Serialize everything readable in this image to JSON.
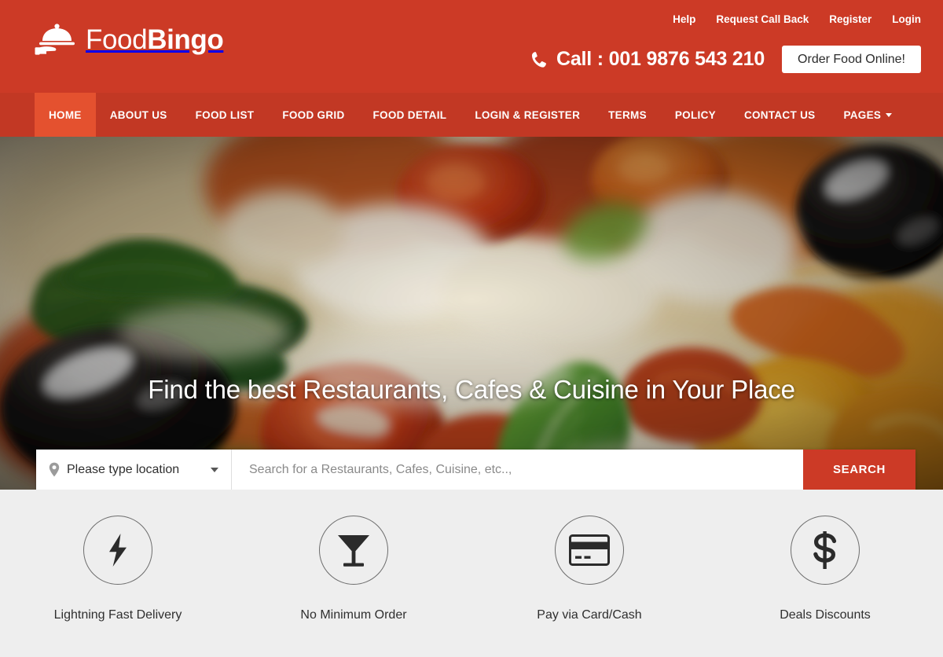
{
  "brand": {
    "name_light": "Food",
    "name_bold": "Bingo",
    "logo_icon": "food-tray-hand-icon",
    "primary_color": "#cc3a26",
    "nav_color": "#c23824",
    "active_color": "#e4512f",
    "features_bg": "#eeeeee"
  },
  "header": {
    "top_links": [
      {
        "label": "Help"
      },
      {
        "label": "Request Call Back"
      },
      {
        "label": "Register"
      },
      {
        "label": "Login"
      }
    ],
    "phone_icon": "phone-icon",
    "call_text": "Call : 001 9876 543 210",
    "order_button": "Order Food Online!"
  },
  "nav": {
    "items": [
      {
        "label": "HOME",
        "active": true,
        "dropdown": false
      },
      {
        "label": "ABOUT US",
        "active": false,
        "dropdown": false
      },
      {
        "label": "FOOD LIST",
        "active": false,
        "dropdown": false
      },
      {
        "label": "FOOD GRID",
        "active": false,
        "dropdown": false
      },
      {
        "label": "FOOD DETAIL",
        "active": false,
        "dropdown": false
      },
      {
        "label": "LOGIN & REGISTER",
        "active": false,
        "dropdown": false
      },
      {
        "label": "TERMS",
        "active": false,
        "dropdown": false
      },
      {
        "label": "POLICY",
        "active": false,
        "dropdown": false
      },
      {
        "label": "CONTACT US",
        "active": false,
        "dropdown": false
      },
      {
        "label": "PAGES",
        "active": false,
        "dropdown": true
      }
    ]
  },
  "hero": {
    "title": "Find the best Restaurants, Cafes & Cuisine in Your Place",
    "background_description": "close-up photo of pizza with basil leaves, tomatoes, black olives and melted cheese",
    "search": {
      "location_icon": "map-pin-icon",
      "location_value": "Please type location",
      "location_caret_icon": "chevron-down-icon",
      "query_value": "",
      "query_placeholder": "Search for a Restaurants, Cafes, Cuisine, etc..,",
      "search_button": "SEARCH"
    }
  },
  "features": {
    "items": [
      {
        "icon": "lightning-bolt-icon",
        "label": "Lightning Fast Delivery"
      },
      {
        "icon": "cocktail-glass-icon",
        "label": "No Minimum Order"
      },
      {
        "icon": "credit-card-icon",
        "label": "Pay via Card/Cash"
      },
      {
        "icon": "dollar-sign-icon",
        "label": "Deals Discounts"
      }
    ]
  }
}
